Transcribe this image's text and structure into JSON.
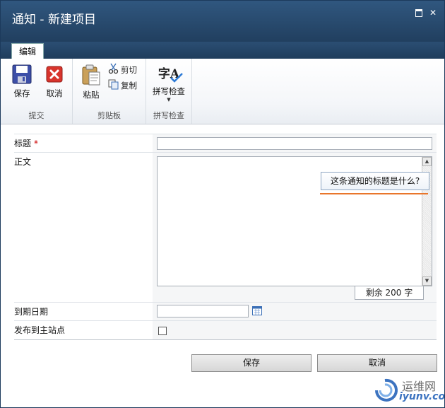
{
  "window": {
    "title": "通知 - 新建项目"
  },
  "tabs": [
    {
      "label": "编辑"
    }
  ],
  "ribbon": {
    "submit_group": {
      "label": "提交",
      "save": "保存",
      "cancel": "取消"
    },
    "clipboard_group": {
      "label": "剪贴板",
      "paste": "粘贴",
      "cut": "剪切",
      "copy": "复制"
    },
    "spelling_group": {
      "label": "拼写检查",
      "spell": "拼写检查",
      "icon_glyph": "字A"
    }
  },
  "form": {
    "title_field": {
      "label": "标题",
      "required_mark": "*",
      "value": ""
    },
    "body_field": {
      "label": "正文",
      "value": "",
      "tooltip": "这条通知的标题是什么?",
      "counter": "剩余 200 字"
    },
    "expiry_field": {
      "label": "到期日期",
      "value": ""
    },
    "publish_field": {
      "label": "发布到主站点",
      "checked": false
    }
  },
  "buttons": {
    "save": "保存",
    "cancel": "取消"
  },
  "watermark": {
    "cn": "运维网",
    "en": "iyunv.com"
  },
  "colors": {
    "title_bar": "#2a4b6e",
    "accent": "#e9762b",
    "required": "#cc0000"
  }
}
